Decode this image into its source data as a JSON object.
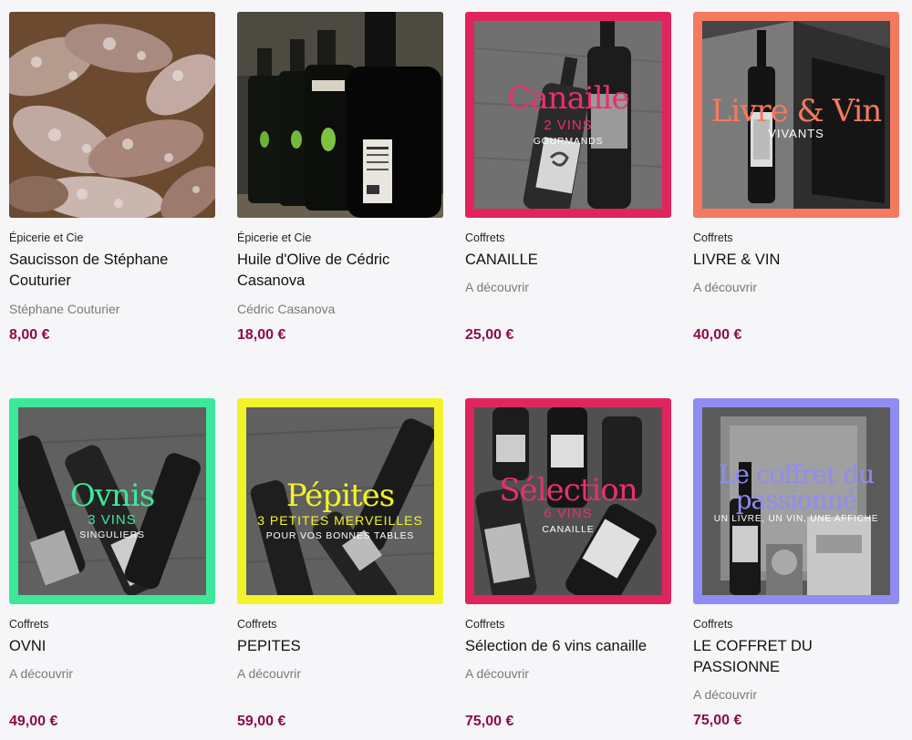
{
  "products": [
    {
      "category": "Épicerie et Cie",
      "title": "Saucisson de Stéphane Couturier",
      "vendor": "Stéphane Couturier",
      "price": "8,00 €"
    },
    {
      "category": "Épicerie et Cie",
      "title": "Huile d'Olive de Cédric Casanova",
      "vendor": "Cédric Casanova",
      "price": "18,00 €"
    },
    {
      "category": "Coffrets",
      "title": "CANAILLE",
      "vendor": "A découvrir",
      "price": "25,00 €",
      "overlay": {
        "title": "Canaille",
        "sub": "2 VINS",
        "sub2": "GOURMANDS"
      }
    },
    {
      "category": "Coffrets",
      "title": "LIVRE & VIN",
      "vendor": "A découvrir",
      "price": "40,00 €",
      "overlay": {
        "title": "Livre & Vin",
        "sub": "VIVANTS"
      }
    },
    {
      "category": "Coffrets",
      "title": "OVNI",
      "vendor": "A découvrir",
      "price": "49,00 €",
      "overlay": {
        "title": "Ovnis",
        "sub": "3 VINS",
        "sub2": "SINGULIERS"
      }
    },
    {
      "category": "Coffrets",
      "title": "PEPITES",
      "vendor": "A découvrir",
      "price": "59,00 €",
      "overlay": {
        "title": "Pépites",
        "sub": "3 PETITES MERVEILLES",
        "sub2": "POUR VOS BONNES TABLES"
      }
    },
    {
      "category": "Coffrets",
      "title": "Sélection de 6 vins canaille",
      "vendor": "A découvrir",
      "price": "75,00 €",
      "overlay": {
        "title": "Sélection",
        "sub": "6 VINS",
        "sub2": "CANAILLE"
      }
    },
    {
      "category": "Coffrets",
      "title": "LE COFFRET DU PASSIONNE",
      "vendor": "A découvrir",
      "price": "75,00 €",
      "overlay": {
        "title": "Le coffret du passionné",
        "sub": "UN LIVRE, UN VIN, UNE AFFICHE"
      }
    }
  ],
  "colors": {
    "price": "#8b0d4c",
    "canaille_frame": "#e0245e",
    "livre_frame": "#f47a5f",
    "ovni_frame": "#3ee89a",
    "pepites_frame": "#f3f32a",
    "selection_frame": "#e0245e",
    "passionne_frame": "#8f8cf2"
  }
}
